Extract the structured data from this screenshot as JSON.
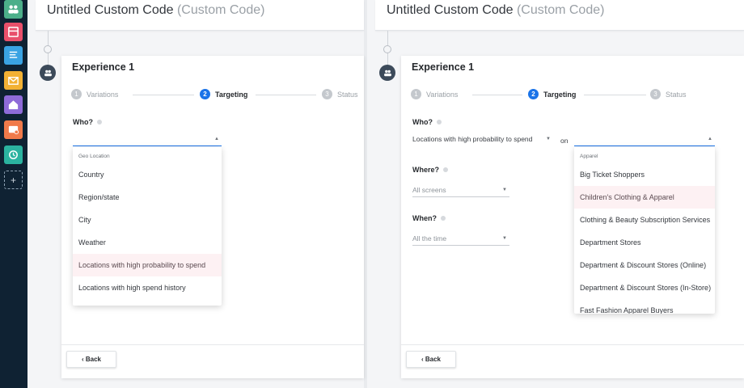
{
  "rail": {
    "items": [
      {
        "icon": "users-icon",
        "color": "#4caf8a"
      },
      {
        "icon": "layout-icon",
        "color": "#e8506b"
      },
      {
        "icon": "text-lines-icon",
        "color": "#3aa3e3"
      },
      {
        "icon": "mail-icon",
        "color": "#f2b134"
      },
      {
        "icon": "house-icon",
        "color": "#8e6bd8"
      },
      {
        "icon": "message-icon",
        "color": "#f07a4a"
      },
      {
        "icon": "refresh-icon",
        "color": "#2bb3a0"
      }
    ],
    "add_label": "+"
  },
  "left": {
    "title": "Untitled Custom Code",
    "title_type": "(Custom Code)",
    "experience": "Experience 1",
    "steps": [
      {
        "num": "1",
        "label": "Variations"
      },
      {
        "num": "2",
        "label": "Targeting"
      },
      {
        "num": "3",
        "label": "Status"
      }
    ],
    "who_label": "Who?",
    "dropdown": {
      "header": "Geo Location",
      "items": [
        "Country",
        "Region/state",
        "City",
        "Weather",
        "Locations with high probability to spend",
        "Locations with high spend history"
      ],
      "highlighted": "Locations with high probability to spend"
    },
    "back_label": "‹ Back"
  },
  "right": {
    "title": "Untitled Custom Code",
    "title_type": "(Custom Code)",
    "experience": "Experience 1",
    "steps": [
      {
        "num": "1",
        "label": "Variations"
      },
      {
        "num": "2",
        "label": "Targeting"
      },
      {
        "num": "3",
        "label": "Status"
      }
    ],
    "who_label": "Who?",
    "who_value": "Locations with high probability to spend",
    "on_label": "on",
    "where_label": "Where?",
    "where_value": "All screens",
    "when_label": "When?",
    "when_value": "All the time",
    "dropdown": {
      "header": "Apparel",
      "items": [
        "Big Ticket Shoppers",
        "Children's Clothing & Apparel",
        "Clothing & Beauty Subscription Services",
        "Department Stores",
        "Department & Discount Stores (Online)",
        "Department & Discount Stores (In-Store)",
        "Fast Fashion Apparel Buyers"
      ],
      "highlighted": "Children's Clothing & Apparel"
    },
    "back_label": "‹ Back"
  },
  "colors": {
    "accent": "#1a73e8",
    "highlight_bg": "#fdf1f3",
    "rail_bg": "#0f2233"
  }
}
